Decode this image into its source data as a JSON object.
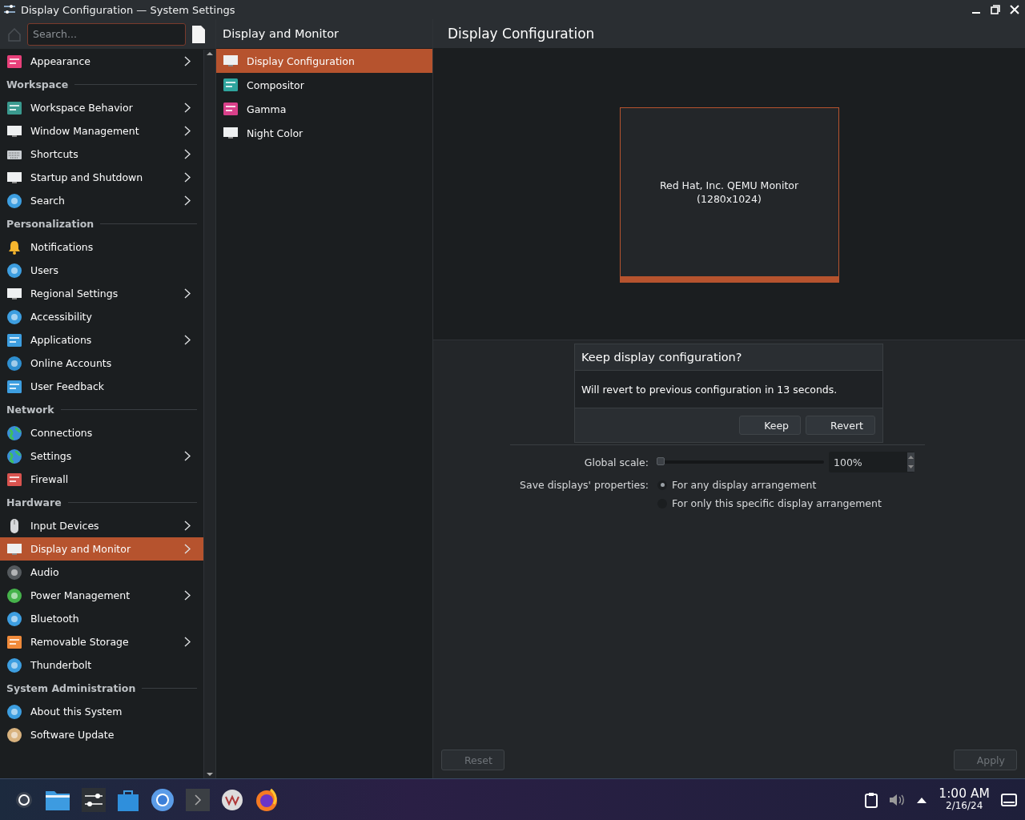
{
  "window": {
    "title": "Display Configuration — System Settings"
  },
  "sidebar": {
    "search": {
      "placeholder": "Search..."
    },
    "items": [
      {
        "kind": "item",
        "label": "Appearance",
        "has_children": true,
        "selected": false
      },
      {
        "kind": "header",
        "label": "Workspace"
      },
      {
        "kind": "item",
        "label": "Workspace Behavior",
        "has_children": true,
        "selected": false
      },
      {
        "kind": "item",
        "label": "Window Management",
        "has_children": true,
        "selected": false
      },
      {
        "kind": "item",
        "label": "Shortcuts",
        "has_children": true,
        "selected": false
      },
      {
        "kind": "item",
        "label": "Startup and Shutdown",
        "has_children": true,
        "selected": false
      },
      {
        "kind": "item",
        "label": "Search",
        "has_children": true,
        "selected": false
      },
      {
        "kind": "header",
        "label": "Personalization"
      },
      {
        "kind": "item",
        "label": "Notifications",
        "has_children": false,
        "selected": false
      },
      {
        "kind": "item",
        "label": "Users",
        "has_children": false,
        "selected": false
      },
      {
        "kind": "item",
        "label": "Regional Settings",
        "has_children": true,
        "selected": false
      },
      {
        "kind": "item",
        "label": "Accessibility",
        "has_children": false,
        "selected": false
      },
      {
        "kind": "item",
        "label": "Applications",
        "has_children": true,
        "selected": false
      },
      {
        "kind": "item",
        "label": "Online Accounts",
        "has_children": false,
        "selected": false
      },
      {
        "kind": "item",
        "label": "User Feedback",
        "has_children": false,
        "selected": false
      },
      {
        "kind": "header",
        "label": "Network"
      },
      {
        "kind": "item",
        "label": "Connections",
        "has_children": false,
        "selected": false
      },
      {
        "kind": "item",
        "label": "Settings",
        "has_children": true,
        "selected": false
      },
      {
        "kind": "item",
        "label": "Firewall",
        "has_children": false,
        "selected": false
      },
      {
        "kind": "header",
        "label": "Hardware"
      },
      {
        "kind": "item",
        "label": "Input Devices",
        "has_children": true,
        "selected": false
      },
      {
        "kind": "item",
        "label": "Display and Monitor",
        "has_children": true,
        "selected": true
      },
      {
        "kind": "item",
        "label": "Audio",
        "has_children": false,
        "selected": false
      },
      {
        "kind": "item",
        "label": "Power Management",
        "has_children": true,
        "selected": false
      },
      {
        "kind": "item",
        "label": "Bluetooth",
        "has_children": false,
        "selected": false
      },
      {
        "kind": "item",
        "label": "Removable Storage",
        "has_children": true,
        "selected": false
      },
      {
        "kind": "item",
        "label": "Thunderbolt",
        "has_children": false,
        "selected": false
      },
      {
        "kind": "header",
        "label": "System Administration"
      },
      {
        "kind": "item",
        "label": "About this System",
        "has_children": false,
        "selected": false
      },
      {
        "kind": "item",
        "label": "Software Update",
        "has_children": false,
        "selected": false
      }
    ]
  },
  "subpage": {
    "title": "Display and Monitor",
    "items": [
      {
        "label": "Display Configuration",
        "selected": true
      },
      {
        "label": "Compositor",
        "selected": false
      },
      {
        "label": "Gamma",
        "selected": false
      },
      {
        "label": "Night Color",
        "selected": false
      }
    ]
  },
  "page": {
    "title": "Display Configuration",
    "monitor": {
      "name": "Red Hat, Inc. QEMU Monitor",
      "resolution": "(1280x1024)"
    },
    "dialog": {
      "title": "Keep display configuration?",
      "message": "Will revert to previous configuration in 13 seconds.",
      "buttons": [
        "Keep",
        "Revert"
      ]
    },
    "global_scale": {
      "label": "Global scale:",
      "level": 0,
      "value": "100%"
    },
    "save_properties": {
      "label": "Save displays' properties:",
      "options": [
        {
          "label": "For any display arrangement",
          "selected": true
        },
        {
          "label": "For only this specific display arrangement",
          "selected": false
        }
      ]
    },
    "buttons": [
      {
        "label": "Reset",
        "disabled": true
      },
      {
        "label": "Apply",
        "disabled": true
      }
    ]
  },
  "taskbar": {
    "time": "1:00 AM",
    "date": "2/16/24"
  }
}
